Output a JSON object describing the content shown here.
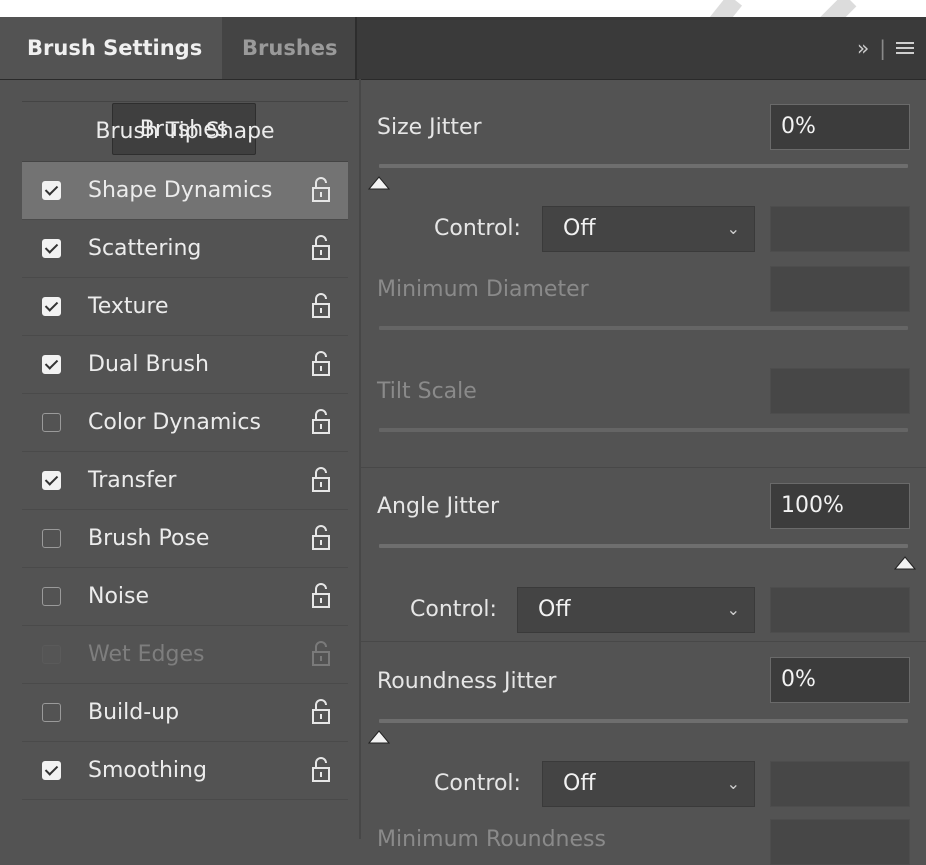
{
  "tabs": {
    "active": "Brush Settings",
    "inactive": "Brushes",
    "expand_glyph": "»",
    "menu_icon": "menu-icon"
  },
  "left": {
    "brushes_button": "Brushes",
    "tip_shape": "Brush Tip Shape",
    "items": [
      {
        "label": "Shape Dynamics",
        "checked": true,
        "selected": true,
        "disabled": false
      },
      {
        "label": "Scattering",
        "checked": true,
        "selected": false,
        "disabled": false
      },
      {
        "label": "Texture",
        "checked": true,
        "selected": false,
        "disabled": false
      },
      {
        "label": "Dual Brush",
        "checked": true,
        "selected": false,
        "disabled": false
      },
      {
        "label": "Color Dynamics",
        "checked": false,
        "selected": false,
        "disabled": false
      },
      {
        "label": "Transfer",
        "checked": true,
        "selected": false,
        "disabled": false
      },
      {
        "label": "Brush Pose",
        "checked": false,
        "selected": false,
        "disabled": false
      },
      {
        "label": "Noise",
        "checked": false,
        "selected": false,
        "disabled": false
      },
      {
        "label": "Wet Edges",
        "checked": false,
        "selected": false,
        "disabled": true
      },
      {
        "label": "Build-up",
        "checked": false,
        "selected": false,
        "disabled": false
      },
      {
        "label": "Smoothing",
        "checked": true,
        "selected": false,
        "disabled": false
      }
    ]
  },
  "right": {
    "size_jitter": {
      "label": "Size Jitter",
      "value": "0%",
      "slider_level": 0
    },
    "size_control": {
      "label": "Control:",
      "value": "Off"
    },
    "min_diameter": {
      "label": "Minimum Diameter"
    },
    "tilt_scale": {
      "label": "Tilt Scale"
    },
    "angle_jitter": {
      "label": "Angle Jitter",
      "value": "100%",
      "slider_level": 1
    },
    "angle_control": {
      "label": "Control:",
      "value": "Off"
    },
    "roundness_jitter": {
      "label": "Roundness Jitter",
      "value": "0%",
      "slider_level": 0
    },
    "roundness_control": {
      "label": "Control:",
      "value": "Off"
    },
    "min_roundness": {
      "label": "Minimum Roundness"
    }
  }
}
